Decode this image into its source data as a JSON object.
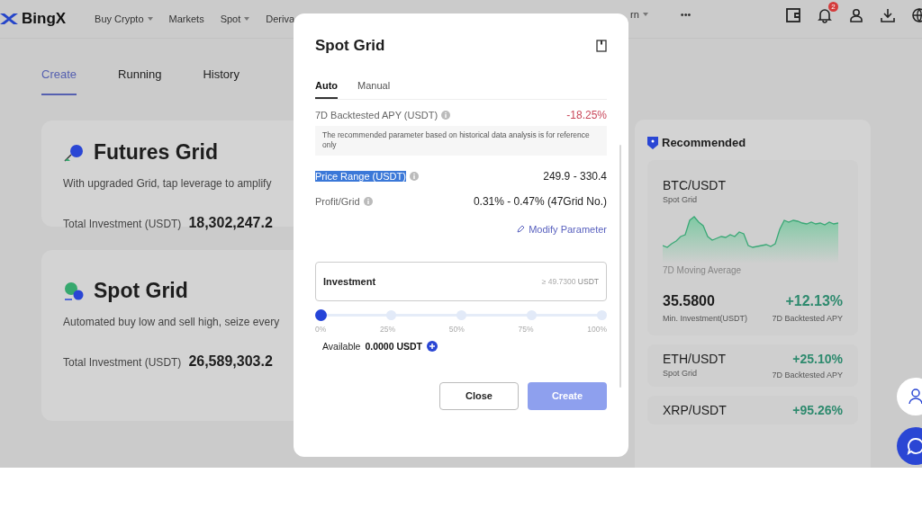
{
  "nav": {
    "logo": "BingX",
    "items": [
      {
        "label": "Buy Crypto",
        "dropdown": true
      },
      {
        "label": "Markets",
        "dropdown": false
      },
      {
        "label": "Spot",
        "dropdown": true
      },
      {
        "label": "Deriva",
        "dropdown": false
      }
    ],
    "items_right": [
      {
        "label": "rn",
        "dropdown": true
      },
      {
        "label": "•••",
        "dropdown": false
      }
    ],
    "notification_count": "2"
  },
  "page_tabs": [
    {
      "label": "Create",
      "selected": true
    },
    {
      "label": "Running",
      "selected": false
    },
    {
      "label": "History",
      "selected": false
    }
  ],
  "products": [
    {
      "kind": "futures",
      "title": "Futures Grid",
      "description": "With upgraded Grid, tap leverage to amplify",
      "total_label": "Total Investment (USDT)",
      "total": "18,302,247.2"
    },
    {
      "kind": "spot",
      "title": "Spot Grid",
      "description": "Automated buy low and sell high, seize every",
      "total_label": "Total Investment (USDT)",
      "total": "26,589,303.2"
    }
  ],
  "recommended": {
    "title": "Recommended",
    "featured": {
      "pair": "BTC/USDT",
      "type": "Spot Grid",
      "chart_caption": "7D Moving Average",
      "min_investment": "35.5800",
      "min_investment_label": "Min. Investment(USDT)",
      "apy": "+12.13%",
      "apy_label": "7D Backtested APY"
    },
    "others": [
      {
        "pair": "ETH/USDT",
        "type": "Spot Grid",
        "apy": "+25.10%",
        "apy_label": "7D Backtested APY"
      },
      {
        "pair": "XRP/USDT",
        "apy": "+95.26%"
      }
    ]
  },
  "modal": {
    "title": "Spot Grid",
    "tabs": [
      {
        "label": "Auto",
        "selected": true
      },
      {
        "label": "Manual",
        "selected": false
      }
    ],
    "apy_label": "7D Backtested APY (USDT)",
    "apy": "-18.25%",
    "note": "The recommended parameter based on historical data analysis is for reference only",
    "params": [
      {
        "label": "Price Range (USDT)",
        "value": "249.9 - 330.4",
        "highlighted": true
      },
      {
        "label": "Profit/Grid",
        "value": "0.31% - 0.47% (47Grid No.)",
        "highlighted": false
      }
    ],
    "modify_link": "Modify Parameter",
    "investment": {
      "label": "Investment",
      "placeholder": "≥ 49.7300",
      "unit": "USDT",
      "level": 0,
      "stops": [
        "0%",
        "25%",
        "50%",
        "75%",
        "100%"
      ]
    },
    "available_label": "Available",
    "available": "0.0000 USDT",
    "buttons": [
      {
        "label": "Close",
        "kind": "secondary",
        "disabled": false
      },
      {
        "label": "Create",
        "kind": "primary",
        "disabled": true
      }
    ]
  }
}
